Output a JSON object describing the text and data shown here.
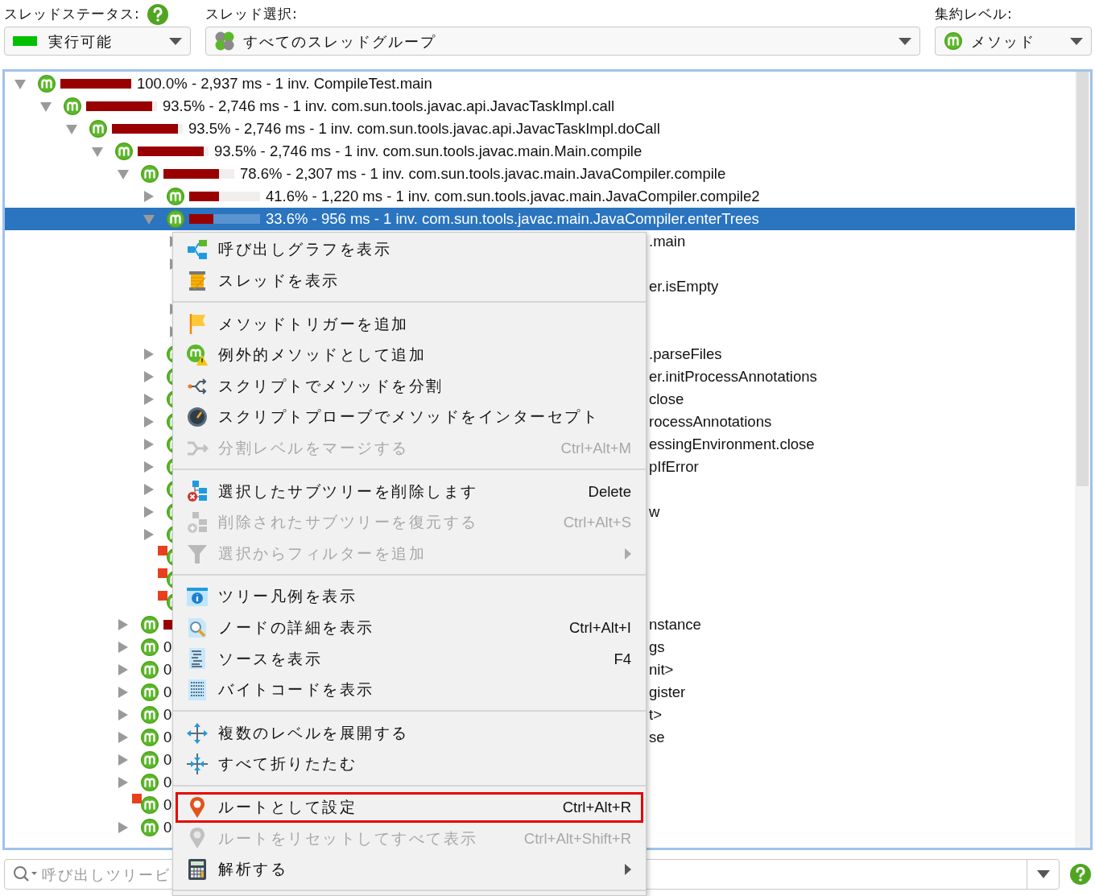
{
  "filters": [
    {
      "label": "スレッドステータス:",
      "help": true,
      "value": "実行可能",
      "color": "#00c000"
    },
    {
      "label": "スレッド選択:",
      "help": false,
      "value": "すべてのスレッドグループ"
    },
    {
      "label": "集約レベル:",
      "help": false,
      "value": "メソッド"
    }
  ],
  "tree": [
    {
      "text": "100.0% - 2,937 ms - 1 inv. CompileTest.main",
      "level": 1.0,
      "expanded": true,
      "selected": false,
      "children": [
        {
          "text": "93.5% - 2,746 ms - 1 inv. com.sun.tools.javac.api.JavacTaskImpl.call",
          "level": 0.935,
          "expanded": true,
          "selected": false,
          "children": [
            {
              "text": "93.5% - 2,746 ms - 1 inv. com.sun.tools.javac.api.JavacTaskImpl.doCall",
              "level": 0.935,
              "expanded": true,
              "selected": false,
              "children": [
                {
                  "text": "93.5% - 2,746 ms - 1 inv. com.sun.tools.javac.main.Main.compile",
                  "level": 0.935,
                  "expanded": true,
                  "selected": false,
                  "children": [
                    {
                      "text": "78.6% - 2,307 ms - 1 inv. com.sun.tools.javac.main.JavaCompiler.compile",
                      "level": 0.786,
                      "expanded": true,
                      "selected": false,
                      "children": [
                        {
                          "text": "41.6% - 1,220 ms - 1 inv. com.sun.tools.javac.main.JavaCompiler.compile2",
                          "level": 0.416,
                          "expanded": false,
                          "selected": false
                        },
                        {
                          "text": "33.6% - 956 ms - 1 inv. com.sun.tools.javac.main.JavaCompiler.enterTrees",
                          "level": 0.336,
                          "expanded": true,
                          "selected": true,
                          "children": [
                            {
                              "tail": ".main",
                              "expanded": false,
                              "selected": false
                            },
                            {
                              "expanded": false,
                              "selected": false
                            },
                            {
                              "tail": "er.isEmpty",
                              "selected": false
                            },
                            {
                              "expanded": false,
                              "selected": false
                            },
                            {
                              "expanded": false,
                              "selected": false
                            }
                          ]
                        },
                        {
                          "tail": ".parseFiles",
                          "expanded": false,
                          "selected": false
                        },
                        {
                          "tail": "er.initProcessAnnotations",
                          "expanded": false,
                          "selected": false
                        },
                        {
                          "tail": "close",
                          "expanded": false,
                          "selected": false
                        },
                        {
                          "tail": "rocessAnnotations",
                          "expanded": false,
                          "selected": false
                        },
                        {
                          "tail": "essingEnvironment.close",
                          "expanded": false,
                          "selected": false
                        },
                        {
                          "tail": "pIfError",
                          "expanded": false,
                          "selected": false
                        },
                        {
                          "expanded": false,
                          "selected": false
                        },
                        {
                          "tail": "w",
                          "expanded": false,
                          "selected": false
                        },
                        {
                          "expanded": false,
                          "selected": false
                        },
                        {
                          "marked": true,
                          "selected": false
                        },
                        {
                          "marked": true,
                          "selected": false
                        },
                        {
                          "marked": true,
                          "selected": false
                        }
                      ]
                    },
                    {
                      "tail": "nstance",
                      "level": 0.14,
                      "expanded": false,
                      "selected": false
                    },
                    {
                      "text": "0",
                      "tail": "gs",
                      "expanded": false,
                      "selected": false
                    },
                    {
                      "text": "0",
                      "tail": "nit>",
                      "expanded": false,
                      "selected": false
                    },
                    {
                      "text": "0",
                      "tail": "gister",
                      "expanded": false,
                      "selected": false
                    },
                    {
                      "text": "0",
                      "tail": "t>",
                      "expanded": false,
                      "selected": false
                    },
                    {
                      "text": "0",
                      "tail": "se",
                      "expanded": false,
                      "selected": false
                    },
                    {
                      "text": "0",
                      "expanded": false,
                      "selected": false
                    },
                    {
                      "text": "0",
                      "expanded": false,
                      "selected": false
                    },
                    {
                      "text": "0",
                      "marked": true,
                      "selected": false
                    },
                    {
                      "text": "0",
                      "expanded": false,
                      "selected": false
                    }
                  ]
                }
              ]
            }
          ]
        }
      ]
    }
  ],
  "search": {
    "placeholder": "呼び出しツリービ"
  },
  "menu": [
    {
      "kind": "item",
      "label": "呼び出しグラフを表示",
      "disabled": false,
      "highlighted": false
    },
    {
      "kind": "item",
      "label": "スレッドを表示",
      "disabled": false,
      "highlighted": false
    },
    {
      "kind": "separator"
    },
    {
      "kind": "item",
      "label": "メソッドトリガーを追加",
      "disabled": false,
      "highlighted": false
    },
    {
      "kind": "item",
      "label": "例外的メソッドとして追加",
      "disabled": false,
      "highlighted": false
    },
    {
      "kind": "item",
      "label": "スクリプトでメソッドを分割",
      "disabled": false,
      "highlighted": false
    },
    {
      "kind": "item",
      "label": "スクリプトプローブでメソッドをインターセプト",
      "disabled": false,
      "highlighted": false
    },
    {
      "kind": "item",
      "label": "分割レベルをマージする",
      "shortcut": "Ctrl+Alt+M",
      "disabled": true,
      "highlighted": false
    },
    {
      "kind": "separator"
    },
    {
      "kind": "item",
      "label": "選択したサブツリーを削除します",
      "shortcut": "Delete",
      "disabled": false,
      "highlighted": false
    },
    {
      "kind": "item",
      "label": "削除されたサブツリーを復元する",
      "shortcut": "Ctrl+Alt+S",
      "disabled": true,
      "highlighted": false
    },
    {
      "kind": "submenu",
      "label": "選択からフィルターを追加",
      "disabled": true,
      "highlighted": false
    },
    {
      "kind": "separator"
    },
    {
      "kind": "item",
      "label": "ツリー凡例を表示",
      "disabled": false,
      "highlighted": false
    },
    {
      "kind": "item",
      "label": "ノードの詳細を表示",
      "shortcut": "Ctrl+Alt+I",
      "disabled": false,
      "highlighted": false
    },
    {
      "kind": "item",
      "label": "ソースを表示",
      "shortcut": "F4",
      "disabled": false,
      "highlighted": false
    },
    {
      "kind": "item",
      "label": "バイトコードを表示",
      "disabled": false,
      "highlighted": false
    },
    {
      "kind": "separator"
    },
    {
      "kind": "item",
      "label": "複数のレベルを展開する",
      "disabled": false,
      "highlighted": false
    },
    {
      "kind": "item",
      "label": "すべて折りたたむ",
      "disabled": false,
      "highlighted": false
    },
    {
      "kind": "separator"
    },
    {
      "kind": "item",
      "label": "ルートとして設定",
      "shortcut": "Ctrl+Alt+R",
      "disabled": false,
      "highlighted": true
    },
    {
      "kind": "item",
      "label": "ルートをリセットしてすべて表示",
      "shortcut": "Ctrl+Alt+Shift+R",
      "disabled": true,
      "highlighted": false
    },
    {
      "kind": "submenu",
      "label": "解析する",
      "disabled": false,
      "highlighted": false
    },
    {
      "kind": "separator"
    }
  ]
}
